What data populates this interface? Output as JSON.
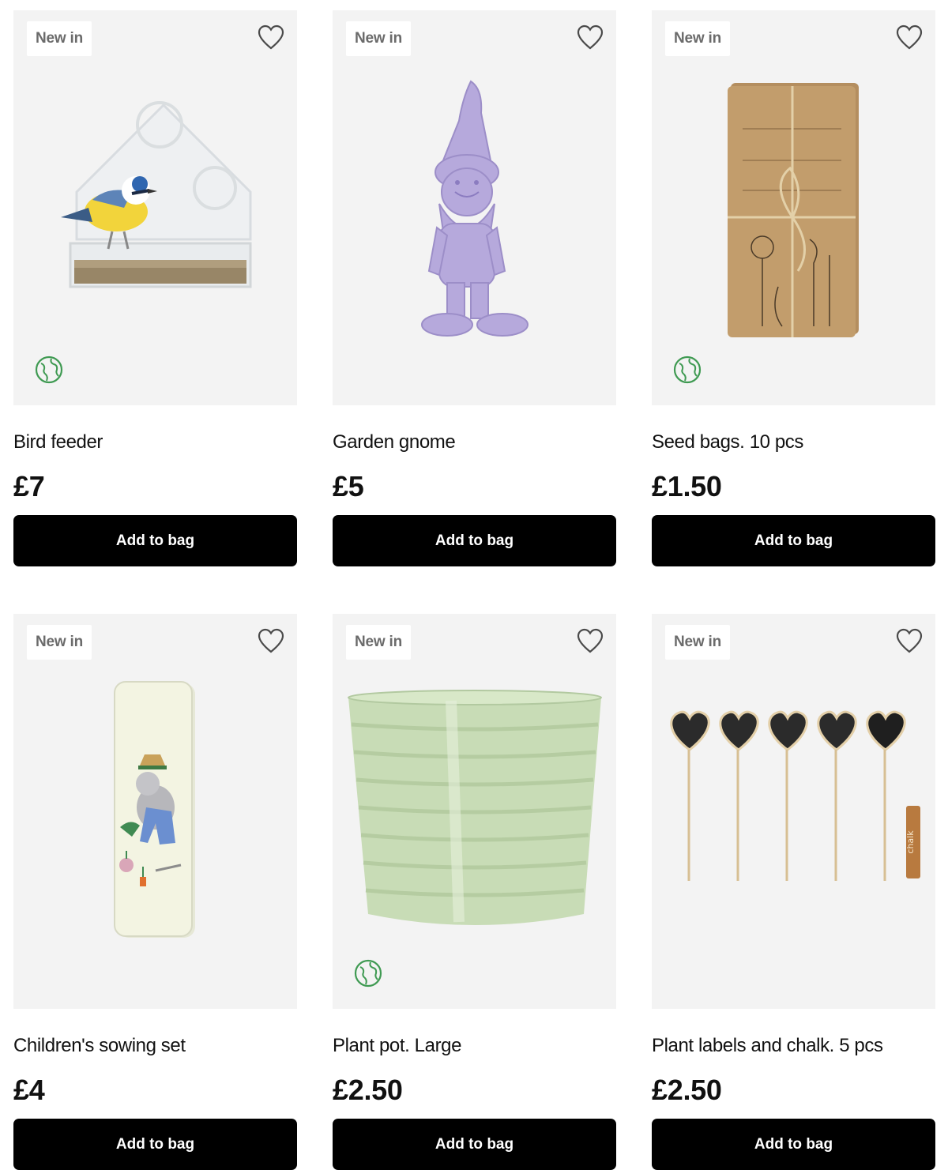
{
  "products": [
    {
      "badge": "New in",
      "title": "Bird feeder",
      "price": "£7",
      "button": "Add to bag",
      "eco": true,
      "icon": "bird-feeder-image"
    },
    {
      "badge": "New in",
      "title": "Garden gnome",
      "price": "£5",
      "button": "Add to bag",
      "eco": false,
      "icon": "garden-gnome-image"
    },
    {
      "badge": "New in",
      "title": "Seed bags. 10 pcs",
      "price": "£1.50",
      "button": "Add to bag",
      "eco": true,
      "icon": "seed-bags-image"
    },
    {
      "badge": "New in",
      "title": "Children's sowing set",
      "price": "£4",
      "button": "Add to bag",
      "eco": false,
      "icon": "sowing-set-image"
    },
    {
      "badge": "New in",
      "title": "Plant pot. Large",
      "price": "£2.50",
      "button": "Add to bag",
      "eco": true,
      "icon": "plant-pot-image"
    },
    {
      "badge": "New in",
      "title": "Plant labels and chalk. 5 pcs",
      "price": "£2.50",
      "button": "Add to bag",
      "eco": false,
      "icon": "plant-labels-image"
    }
  ],
  "colors": {
    "card_bg": "#f3f3f3",
    "button_bg": "#000000",
    "button_text": "#ffffff",
    "eco_green": "#3f9a52",
    "badge_text": "#6b6b6b"
  },
  "labels": {
    "chalk": "chalk"
  }
}
